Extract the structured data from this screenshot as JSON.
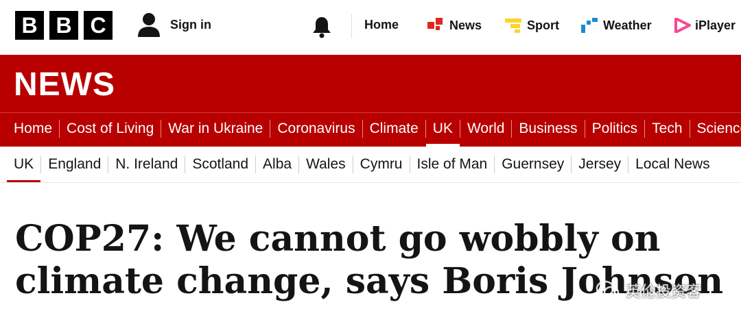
{
  "logo": {
    "letters": [
      "B",
      "B",
      "C"
    ]
  },
  "header": {
    "signin_label": "Sign in",
    "nav": [
      {
        "label": "Home",
        "icon": ""
      },
      {
        "label": "News",
        "icon": "news-icon",
        "color": "#e1261c"
      },
      {
        "label": "Sport",
        "icon": "sport-icon",
        "color": "#ffd230"
      },
      {
        "label": "Weather",
        "icon": "weather-icon",
        "color": "#1b8bd4"
      },
      {
        "label": "iPlayer",
        "icon": "iplayer-icon",
        "color": "#f54997"
      }
    ]
  },
  "brand": {
    "title": "NEWS",
    "color": "#b80000"
  },
  "section_nav": {
    "items": [
      "Home",
      "Cost of Living",
      "War in Ukraine",
      "Coronavirus",
      "Climate",
      "UK",
      "World",
      "Business",
      "Politics",
      "Tech",
      "Science"
    ],
    "active": "UK"
  },
  "sub_nav": {
    "items": [
      "UK",
      "England",
      "N. Ireland",
      "Scotland",
      "Alba",
      "Wales",
      "Cymru",
      "Isle of Man",
      "Guernsey",
      "Jersey",
      "Local News"
    ],
    "active": "UK"
  },
  "article": {
    "headline": "COP27: We cannot go wobbly on climate change, says Boris Johnson"
  },
  "watermark": {
    "text": "英伦投资客"
  }
}
